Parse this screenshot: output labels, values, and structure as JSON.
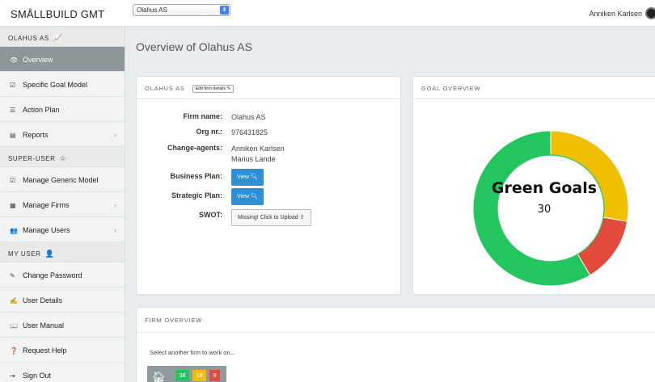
{
  "header": {
    "brand": "SMÅLLBUILD GMT",
    "firm_select_value": "Olahus AS",
    "user_name": "Anniken Karlsen"
  },
  "sidebar": {
    "section_firm": "OLAHUS AS",
    "items_firm": [
      {
        "label": "Overview",
        "icon": "eye-icon",
        "active": true
      },
      {
        "label": "Specific Goal Model",
        "icon": "checkbox-icon"
      },
      {
        "label": "Action Plan",
        "icon": "list-icon"
      },
      {
        "label": "Reports",
        "icon": "report-icon",
        "chevron": true
      }
    ],
    "section_super": "SUPER-USER",
    "items_super": [
      {
        "label": "Manage Generic Model",
        "icon": "checkbox-icon"
      },
      {
        "label": "Manage Firms",
        "icon": "building-icon",
        "chevron": true
      },
      {
        "label": "Manage Users",
        "icon": "users-icon",
        "chevron": true
      }
    ],
    "section_user": "MY USER",
    "items_user": [
      {
        "label": "Change Password",
        "icon": "pencil-icon"
      },
      {
        "label": "User Details",
        "icon": "edit-icon"
      },
      {
        "label": "User Manual",
        "icon": "book-icon"
      },
      {
        "label": "Request Help",
        "icon": "question-icon"
      },
      {
        "label": "Sign Out",
        "icon": "signout-icon"
      }
    ]
  },
  "main": {
    "page_title": "Overview of Olahus AS",
    "firm_panel": {
      "title": "OLAHUS AS",
      "edit_label": "Edit firm details",
      "firm_name_label": "Firm name:",
      "firm_name": "Olahus AS",
      "org_label": "Org nr.:",
      "org_nr": "976431825",
      "agents_label": "Change-agents:",
      "agents": [
        "Anniken Karlsen",
        "Marius Lande"
      ],
      "business_plan_label": "Business Plan:",
      "strategic_plan_label": "Strategic Plan:",
      "view_label": "View",
      "swot_label": "SWOT:",
      "swot_button": "Missing! Click to Upload"
    },
    "goal_panel": {
      "title": "GOAL OVERVIEW",
      "center_label": "Green Goals",
      "center_value": "30"
    },
    "firm_overview": {
      "title": "FIRM OVERVIEW",
      "select_text": "Select another firm to work on...",
      "counts": {
        "green": "38",
        "yellow": "18",
        "red": "9"
      }
    }
  },
  "colors": {
    "green": "#22c55e",
    "yellow": "#f0c000",
    "red": "#e24b3b",
    "sidebar_active": "#8c9597",
    "button_blue": "#2d8fd5"
  },
  "chart_data": {
    "type": "pie",
    "categories": [
      "Green",
      "Yellow",
      "Red"
    ],
    "values": [
      38,
      18,
      9
    ]
  }
}
